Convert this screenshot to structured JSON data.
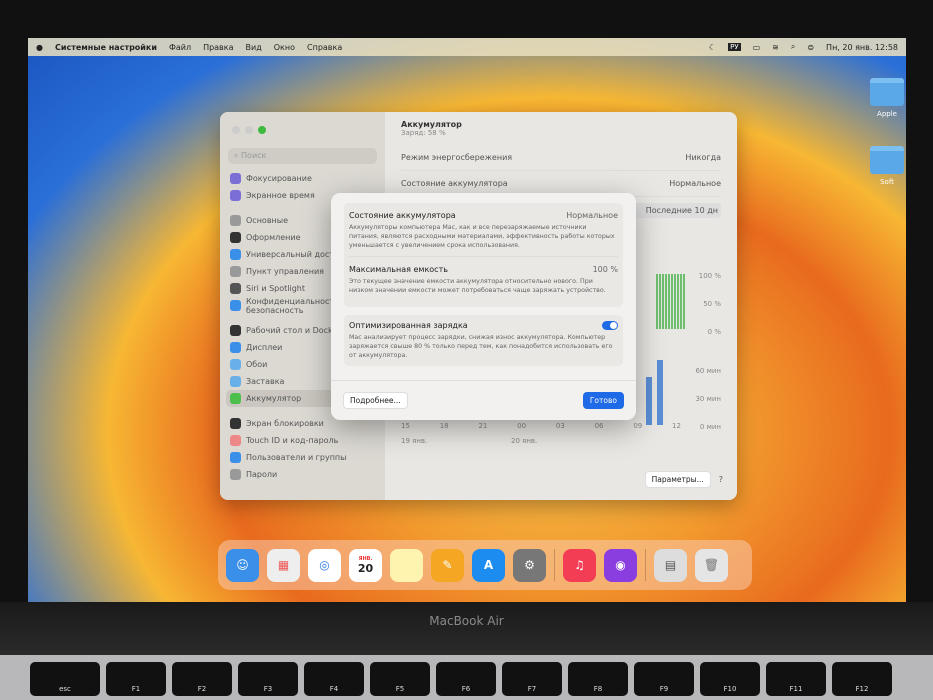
{
  "menubar": {
    "app": "Системные настройки",
    "items": [
      "Файл",
      "Правка",
      "Вид",
      "Окно",
      "Справка"
    ],
    "input_lang": "РУ",
    "clock": "Пн, 20 янв.  12:58"
  },
  "desktop": {
    "icons": [
      "Apple",
      "Soft"
    ]
  },
  "window": {
    "search_placeholder": "Поиск",
    "sidebar": [
      "Фокусирование",
      "Экранное время",
      "Основные",
      "Оформление",
      "Универсальный доступ",
      "Пункт управления",
      "Siri и Spotlight",
      "Конфиденциальность и безопасность",
      "Рабочий стол и Dock",
      "Дисплеи",
      "Обои",
      "Заставка",
      "Аккумулятор",
      "Экран блокировки",
      "Touch ID и код-пароль",
      "Пользователи и группы",
      "Пароли"
    ],
    "title": "Аккумулятор",
    "subtitle": "Заряд: 58 %",
    "low_power_label": "Режим энергосбережения",
    "low_power_value": "Никогда",
    "health_label": "Состояние аккумулятора",
    "health_value": "Нормальное",
    "range_tab": "Последние 10 дн",
    "chart_level_ticks": [
      "100 %",
      "50 %",
      "0 %"
    ],
    "chart_usage_ticks": [
      "60 мин",
      "30 мин",
      "0 мин"
    ],
    "x_ticks": [
      "15",
      "18",
      "21",
      "00",
      "03",
      "06",
      "09",
      "12"
    ],
    "dates": [
      "19 янв.",
      "20 янв."
    ],
    "options_button": "Параметры...",
    "help": "?"
  },
  "modal": {
    "health_title": "Состояние аккумулятора",
    "health_value": "Нормальное",
    "health_desc": "Аккумуляторы компьютера Mac, как и все перезаряжаемые источники питания, являются расходными материалами, эффективность работы которых уменьшается с увеличением срока использования.",
    "capacity_title": "Максимальная емкость",
    "capacity_value": "100 %",
    "capacity_desc": "Это текущее значение емкости аккумулятора относительно нового. При низком значении емкости может потребоваться чаще заряжать устройство.",
    "optimized_title": "Оптимизированная зарядка",
    "optimized_desc": "Mac анализирует процесс зарядки, снижая износ аккумулятора. Компьютер заряжается свыше 80 % только перед тем, как понадобится использовать его от аккумулятора.",
    "optimized_on": true,
    "more_button": "Подробнее...",
    "done_button": "Готово"
  },
  "dock": {
    "calendar_month": "ЯНВ.",
    "calendar_day": "20"
  },
  "laptop": {
    "model": "MacBook Air",
    "keys": [
      "esc",
      "F1",
      "F2",
      "F3",
      "F4",
      "F5",
      "F6",
      "F7",
      "F8",
      "F9",
      "F10",
      "F11",
      "F12"
    ]
  }
}
